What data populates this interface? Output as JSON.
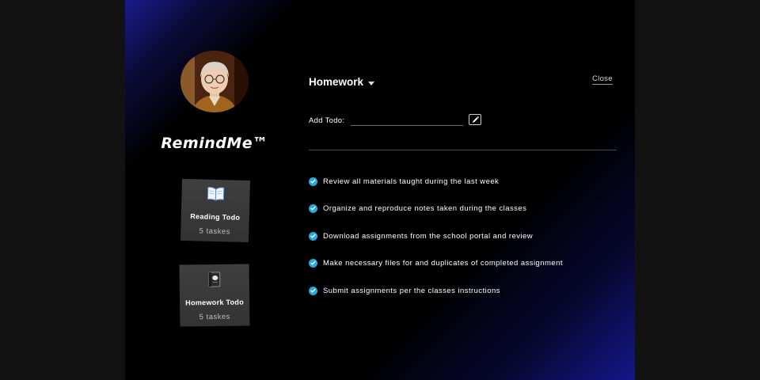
{
  "app": {
    "brand": "RemindMe™"
  },
  "sidebar": {
    "cards": [
      {
        "icon": "open-book-icon",
        "title": "Reading Todo",
        "count": "5 taskes"
      },
      {
        "icon": "notebook-icon",
        "title": "Homework Todo",
        "count": "5 taskes"
      }
    ]
  },
  "main": {
    "list_title": "Homework",
    "close_label": "Close",
    "add_todo": {
      "label": "Add Todo:",
      "value": "",
      "placeholder": ""
    },
    "todos": [
      {
        "text": "Review all materials taught during the last week",
        "done": true
      },
      {
        "text": "Organize and reproduce notes taken during the classes",
        "done": true
      },
      {
        "text": "Download assignments from the school portal and review",
        "done": true
      },
      {
        "text": "Make necessary files for and duplicates of completed assignment",
        "done": true
      },
      {
        "text": "Submit assignments per the classes instructions",
        "done": true
      }
    ]
  },
  "colors": {
    "background": "#121212",
    "panel": "#000000",
    "accent_blue": "#1a1c8c",
    "check": "#28a9d9",
    "card": "#3a3a3a"
  }
}
